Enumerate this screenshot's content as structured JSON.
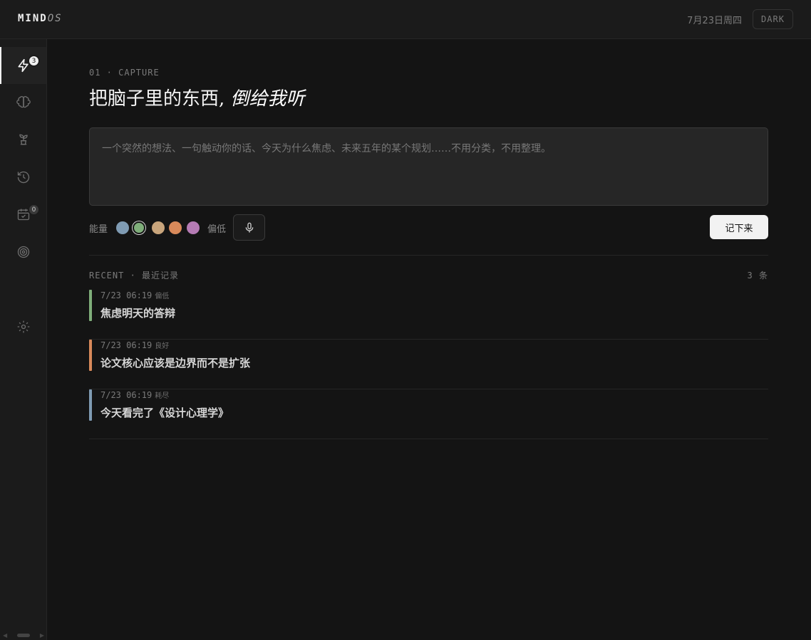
{
  "app": {
    "logo_main": "MIND",
    "logo_suffix": "OS"
  },
  "header": {
    "date": "7月23日周四",
    "theme_label": "DARK"
  },
  "sidebar": {
    "items": [
      {
        "icon": "lightning-icon",
        "badge": "3",
        "active": true
      },
      {
        "icon": "brain-icon",
        "badge": ""
      },
      {
        "icon": "sprout-icon",
        "badge": ""
      },
      {
        "icon": "history-icon",
        "badge": ""
      },
      {
        "icon": "calendar-check-icon",
        "badge": "0"
      },
      {
        "icon": "target-icon",
        "badge": ""
      },
      {
        "icon": "gear-icon",
        "badge": ""
      }
    ]
  },
  "capture": {
    "section_label": "01 · CAPTURE",
    "headline_plain": "把脑子里的东西,",
    "headline_italic": "倒给我听",
    "placeholder": "一个突然的想法、一句触动你的话、今天为什么焦虑、未来五年的某个规划……不用分类，不用整理。",
    "energy_label": "能量",
    "energy_state": "偏低",
    "energy_colors": [
      "#7f9bb3",
      "#7fae7a",
      "#c9a57c",
      "#d8895a",
      "#b57bb4"
    ],
    "energy_selected_index": 1,
    "save_label": "记下来"
  },
  "recent": {
    "header": "RECENT · 最近记录",
    "count": "3 条",
    "records": [
      {
        "time": "7/23 06:19",
        "tag": "偏低",
        "text": "焦虑明天的答辩",
        "color": "#7fae7a"
      },
      {
        "time": "7/23 06:19",
        "tag": "良好",
        "text": "论文核心应该是边界而不是扩张",
        "color": "#d8895a"
      },
      {
        "time": "7/23 06:19",
        "tag": "耗尽",
        "text": "今天看完了《设计心理学》",
        "color": "#7f9bb3"
      }
    ]
  }
}
